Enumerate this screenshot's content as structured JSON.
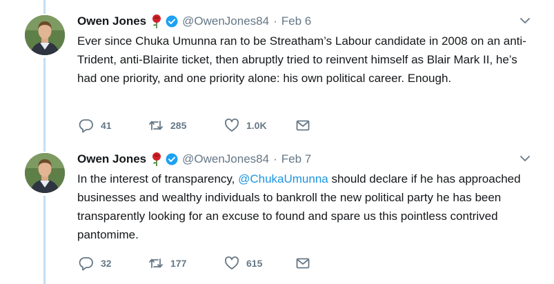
{
  "colors": {
    "text": "#14171a",
    "secondary": "#657786",
    "link": "#1b95e0",
    "verified": "#1da1f2",
    "thread_line": "#c4def5",
    "rose": "#d0212a"
  },
  "tweets": [
    {
      "author_name": "Owen Jones",
      "handle": "@OwenJones84",
      "separator": "·",
      "date": "Feb 6",
      "text": "Ever since Chuka Umunna ran to be Streatham’s Labour candidate in 2008 on an anti-Trident, anti-Blairite ticket, then abruptly tried to reinvent himself as Blair Mark II, he’s had one priority, and one priority alone: his own political career. Enough.",
      "replies": "41",
      "retweets": "285",
      "likes": "1.0K",
      "icons": [
        "rose-icon",
        "verified-badge-icon",
        "chevron-down-icon",
        "reply-icon",
        "retweet-icon",
        "heart-icon",
        "envelope-icon"
      ]
    },
    {
      "author_name": "Owen Jones",
      "handle": "@OwenJones84",
      "separator": "·",
      "date": "Feb 7",
      "text_before": "In the interest of transparency, ",
      "mention": "@ChukaUmunna",
      "text_after": " should declare if he has approached businesses and wealthy individuals to bankroll the new political party he has been transparently looking for an excuse to found and spare us this pointless contrived pantomime.",
      "replies": "32",
      "retweets": "177",
      "likes": "615",
      "icons": [
        "rose-icon",
        "verified-badge-icon",
        "chevron-down-icon",
        "reply-icon",
        "retweet-icon",
        "heart-icon",
        "envelope-icon"
      ]
    }
  ]
}
